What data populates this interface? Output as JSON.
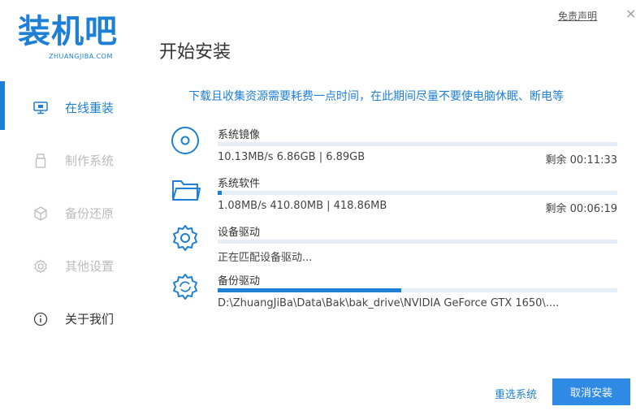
{
  "brand": {
    "logo_text": "装机吧",
    "logo_sub": "ZHUANGJIBA.COM"
  },
  "header": {
    "title": "开始安装",
    "disclaimer": "免责声明",
    "close": "×"
  },
  "sidebar": {
    "items": [
      {
        "label": "在线重装",
        "icon": "monitor-icon",
        "state": "active"
      },
      {
        "label": "制作系统",
        "icon": "usb-icon",
        "state": "disabled"
      },
      {
        "label": "备份还原",
        "icon": "cube-icon",
        "state": "disabled"
      },
      {
        "label": "其他设置",
        "icon": "gear-icon",
        "state": "disabled"
      },
      {
        "label": "关于我们",
        "icon": "info-icon",
        "state": "normal"
      }
    ]
  },
  "main": {
    "notice": "下载且收集资源需要耗费一点时间，在此期间尽量不要使电脑休眠、断电等",
    "tasks": [
      {
        "name": "系统镜像",
        "icon": "disc-icon",
        "info": "10.13MB/s 6.86GB | 6.89GB",
        "remaining": "剩余 00:11:33",
        "progress": 0.0
      },
      {
        "name": "系统软件",
        "icon": "folder-icon",
        "info": "1.08MB/s 410.80MB | 418.86MB",
        "remaining": "剩余 00:06:19",
        "progress": 0.01
      },
      {
        "name": "设备驱动",
        "icon": "gear-icon",
        "info": "正在匹配设备驱动...",
        "remaining": "",
        "progress": 0.0
      },
      {
        "name": "备份驱动",
        "icon": "gear-refresh-icon",
        "info": "D:\\ZhuangJiBa\\Data\\Bak\\bak_drive\\NVIDIA GeForce GTX 1650\\....",
        "remaining": "",
        "progress": 0.46
      }
    ]
  },
  "footer": {
    "reselect": "重选系统",
    "cancel": "取消安装"
  },
  "colors": {
    "accent": "#1e7fd6",
    "track": "#e6eef8",
    "button": "#2f8ae5"
  }
}
